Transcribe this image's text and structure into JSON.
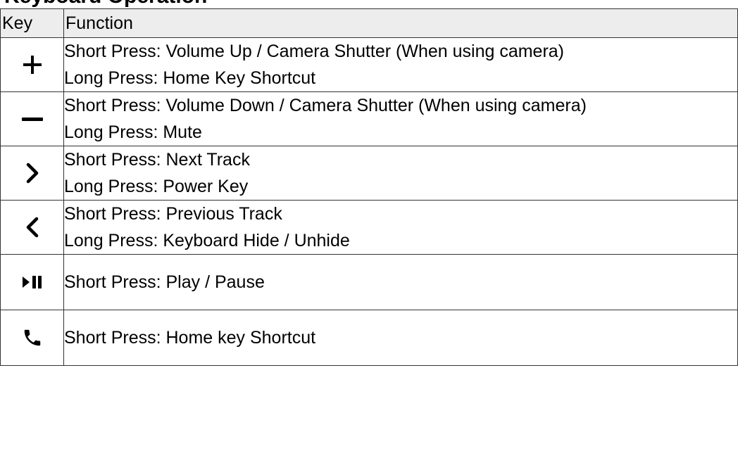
{
  "title": "Keyboard Operation",
  "table": {
    "headers": [
      "Key",
      "Function"
    ],
    "rows": [
      {
        "icon": "plus-icon",
        "lines": [
          "Short Press: Volume Up / Camera Shutter (When using camera)",
          "Long Press: Home Key Shortcut"
        ]
      },
      {
        "icon": "minus-icon",
        "lines": [
          "Short Press: Volume Down / Camera Shutter (When using camera)",
          "Long Press: Mute"
        ]
      },
      {
        "icon": "chevron-right-icon",
        "lines": [
          "Short Press: Next Track",
          "Long Press: Power Key"
        ]
      },
      {
        "icon": "chevron-left-icon",
        "lines": [
          "Short Press: Previous Track",
          "Long Press: Keyboard Hide / Unhide"
        ]
      },
      {
        "icon": "play-pause-icon",
        "lines": [
          "Short Press: Play / Pause"
        ]
      },
      {
        "icon": "phone-icon",
        "lines": [
          "Short Press: Home key Shortcut"
        ]
      }
    ]
  },
  "colors": {
    "header_bg": "#ededed",
    "border": "#333333"
  }
}
